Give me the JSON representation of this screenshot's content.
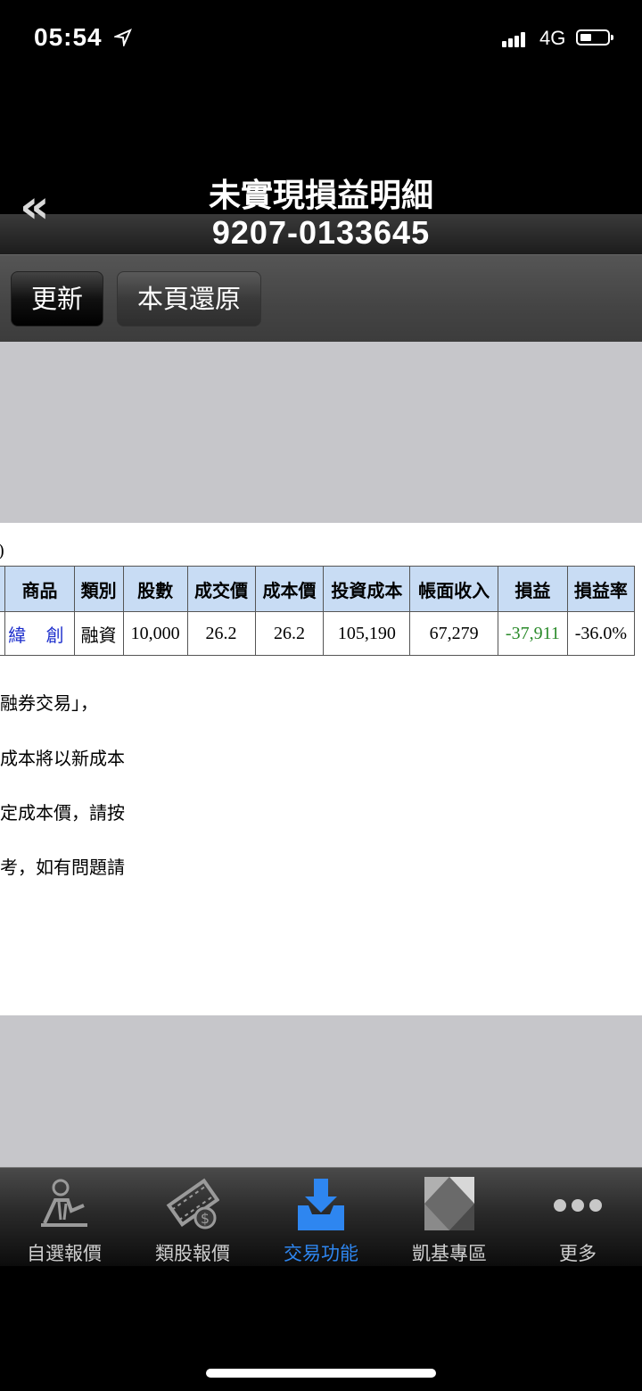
{
  "status_bar": {
    "time": "05:54",
    "network": "4G"
  },
  "header": {
    "title": "未實現損益明細",
    "account": "9207-0133645",
    "back_label": "«"
  },
  "toolbar": {
    "refresh_label": "更新",
    "reset_label": "本頁還原"
  },
  "content": {
    "paren_text": ")",
    "table": {
      "headers": [
        "商品",
        "類別",
        "股數",
        "成交價",
        "成本價",
        "投資成本",
        "帳面收入",
        "損益",
        "損益率"
      ],
      "rows": [
        {
          "product": "緯 創",
          "type": "融資",
          "shares": "10,000",
          "deal_price": "26.2",
          "cost_price": "26.2",
          "invest_cost": "105,190",
          "book_income": "67,279",
          "pnl": "-37,911",
          "pnl_rate": "-36.0%"
        }
      ]
    },
    "notes": [
      "融券交易」，",
      "成本將以新成本",
      "定成本價，請按",
      "考，如有問題請"
    ]
  },
  "colors": {
    "loss": "#2a8a2a",
    "product_link": "#1a2ccc",
    "header_bg": "#c8dcf4",
    "active_tab": "#2e86f0"
  },
  "tabs": [
    {
      "label": "自選報價",
      "icon": "person-chart-icon"
    },
    {
      "label": "類股報價",
      "icon": "film-dollar-icon"
    },
    {
      "label": "交易功能",
      "icon": "download-tray-icon",
      "active": true
    },
    {
      "label": "凱基專區",
      "icon": "kgi-logo-icon"
    },
    {
      "label": "更多",
      "icon": "more-dots-icon"
    }
  ]
}
